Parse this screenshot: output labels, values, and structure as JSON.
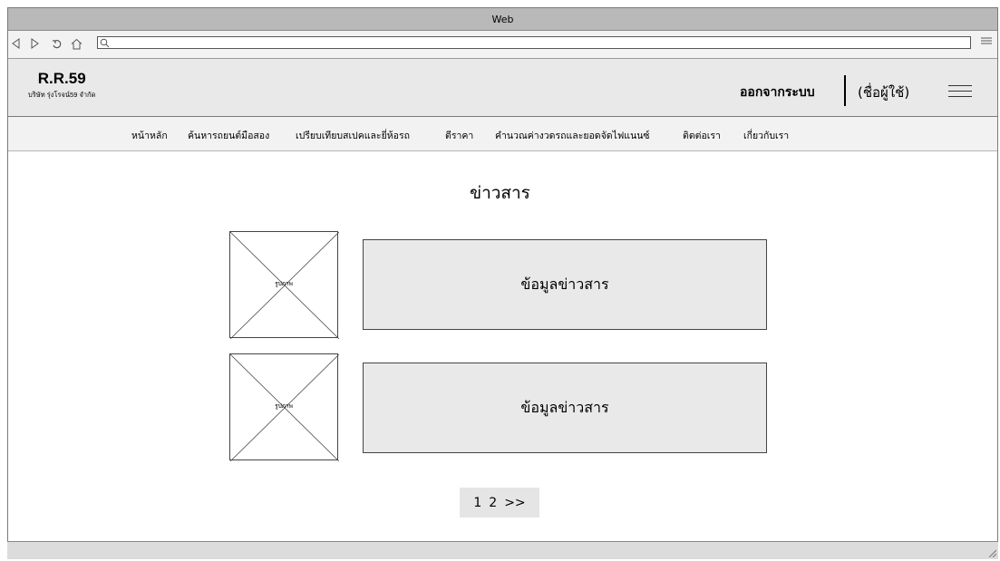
{
  "window": {
    "title": "Web"
  },
  "browser": {
    "icons": [
      "back-icon",
      "forward-icon",
      "refresh-icon",
      "home-icon",
      "search-icon",
      "menu-icon"
    ],
    "address_value": ""
  },
  "header": {
    "brand_name": "R.R.59",
    "brand_subtitle": "บริษัท รุ่งโรจน์59 จำกัด",
    "logout_label": "ออกจากระบบ",
    "username_label": "(ชื่อผู้ใช้)"
  },
  "menu": {
    "items": [
      "หน้าหลัก",
      "ค้นหารถยนต์มือสอง",
      "เปรียบเทียบสเปคและยี่ห้อรถ",
      "ตีราคา",
      "คำนวณค่างวดรถและยอดจัดไฟแนนซ์",
      "ติดต่อเรา",
      "เกี่ยวกับเรา"
    ]
  },
  "content": {
    "title": "ข่าวสาร",
    "news": [
      {
        "image_label": "รูปภาพ",
        "text": "ข้อมูลข่าวสาร"
      },
      {
        "image_label": "รูปภาพ",
        "text": "ข้อมูลข่าวสาร"
      }
    ]
  },
  "pagination": {
    "pages": [
      "1",
      "2"
    ],
    "next_label": ">>"
  }
}
